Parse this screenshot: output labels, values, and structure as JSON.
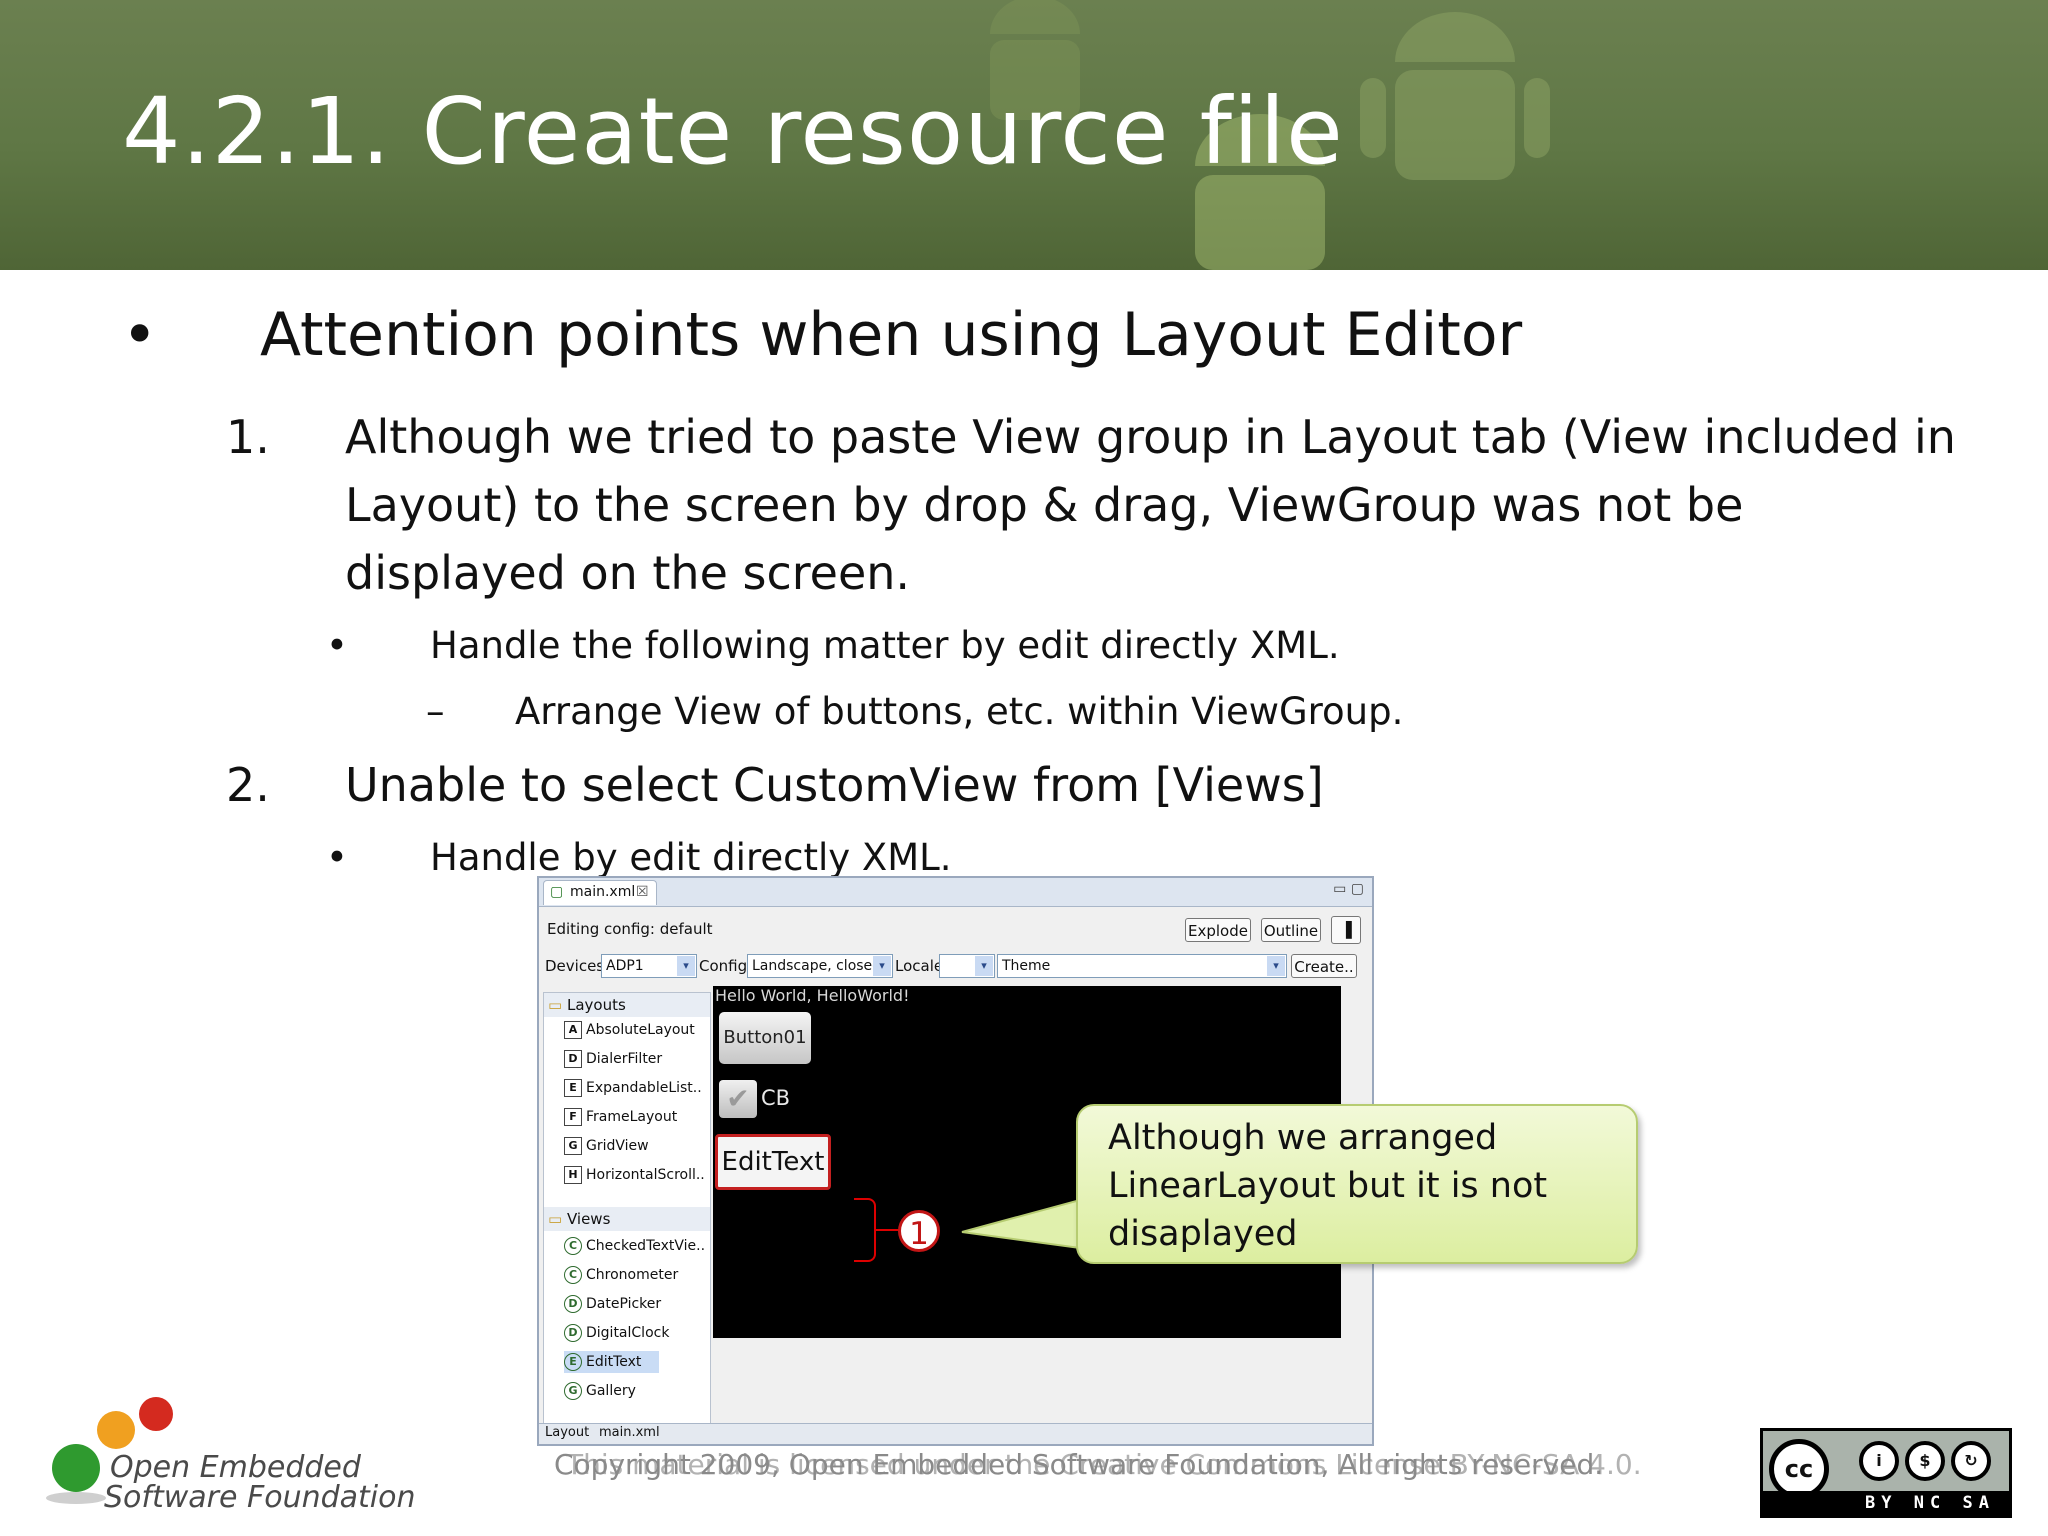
{
  "title": "4.2.1. Create resource file",
  "bullet_glyph": "•",
  "heading": "Attention points when using Layout Editor",
  "point1": {
    "num": "1.",
    "lines": [
      "Although we tried to paste View group in Layout tab (View included in",
      "Layout) to the screen by drop & drag, ViewGroup was not be",
      "displayed on the screen."
    ],
    "sub_bullet": "Handle the following matter by edit directly XML.",
    "sub_dash": "–",
    "sub_sub": "Arrange View of buttons, etc. within ViewGroup."
  },
  "point2": {
    "num": "2.",
    "text": "Unable to select CustomView from [Views]",
    "sub_bullet": "Handle by edit directly XML."
  },
  "editor": {
    "tab_label": "main.xml",
    "tab_close": "☒",
    "window_controls": "▭ ▢",
    "editing_config": "Editing config: default",
    "buttons": {
      "explode": "Explode",
      "outline": "Outline",
      "toggle_icon": "▐"
    },
    "devices_label": "Devices",
    "devices_value": "ADP1",
    "config_label": "Config",
    "config_value": "Landscape, closec",
    "locale_label": "Locale",
    "locale_value": "",
    "theme_value": "Theme",
    "create_label": "Create..",
    "dropdown_glyph": "▾",
    "palette": {
      "layouts_label": "Layouts",
      "layouts": [
        {
          "icon": "A",
          "label": "AbsoluteLayout"
        },
        {
          "icon": "D",
          "label": "DialerFilter"
        },
        {
          "icon": "E",
          "label": "ExpandableList.."
        },
        {
          "icon": "F",
          "label": "FrameLayout"
        },
        {
          "icon": "G",
          "label": "GridView"
        },
        {
          "icon": "H",
          "label": "HorizontalScroll.."
        }
      ],
      "views_label": "Views",
      "views": [
        {
          "icon": "C",
          "label": "CheckedTextVie.."
        },
        {
          "icon": "C",
          "label": "Chronometer"
        },
        {
          "icon": "D",
          "label": "DatePicker"
        },
        {
          "icon": "D",
          "label": "DigitalClock"
        },
        {
          "icon": "E",
          "label": "EditText"
        },
        {
          "icon": "G",
          "label": "Gallery"
        }
      ]
    },
    "canvas": {
      "hello": "Hello World, HelloWorld!",
      "button": "Button01",
      "checkmark": "✔",
      "checkbox_label": "CB",
      "edittext": "EditText"
    },
    "bottom_tabs": [
      "Layout",
      "main.xml"
    ]
  },
  "annotation_number": "1",
  "callout_lines": [
    "Although we arranged",
    "LinearLayout but it is not",
    "disaplayed"
  ],
  "footer_copyright": "Copyright 2009, Open Embedded Software Foundation, All rights reserved.",
  "footer_license": "This material is licensed under the Creative Commons License BY-NC-SA 4.0.",
  "logo_line1": "Open Embedded",
  "logo_line2": "Software Foundation",
  "cc_badge": {
    "main": "cc",
    "by": "BY",
    "nc": "NC",
    "sa": "SA"
  },
  "colors": {
    "banner": "#5f7745",
    "accent_red": "#c21515",
    "callout_fill": "#e6f3b8"
  }
}
